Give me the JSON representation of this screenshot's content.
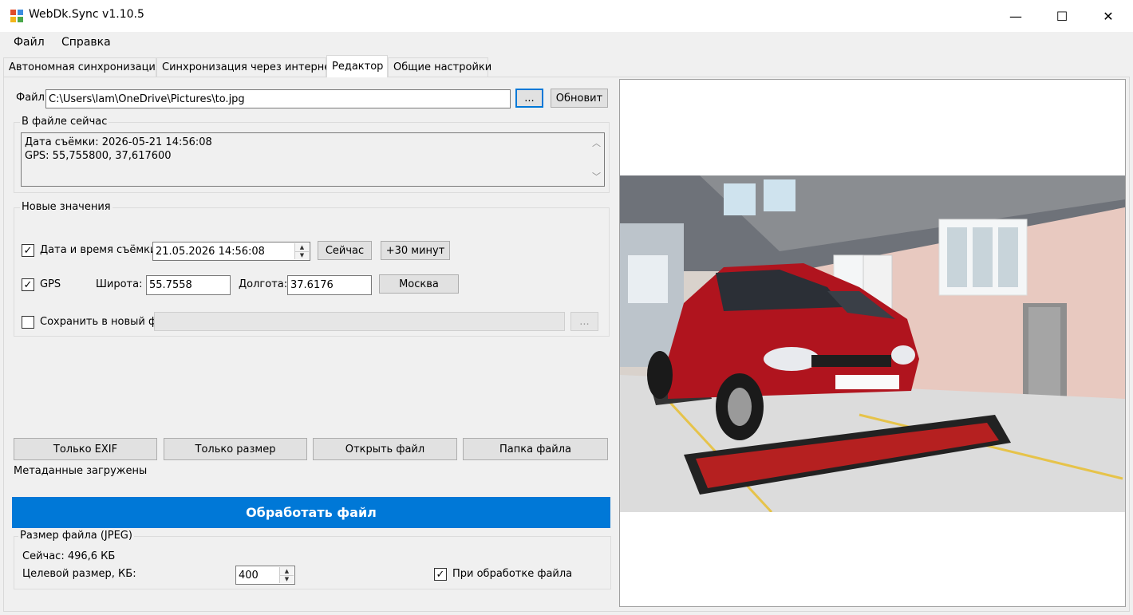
{
  "window": {
    "title": "WebDk.Sync v1.10.5",
    "minimize": "—",
    "maximize": "☐",
    "close": "✕"
  },
  "menu": {
    "file": "Файл",
    "help": "Справка"
  },
  "tabs": [
    {
      "label": "Автономная синхронизация"
    },
    {
      "label": "Синхронизация через интернет"
    },
    {
      "label": "Редактор"
    },
    {
      "label": "Общие настройки"
    }
  ],
  "file": {
    "label": "Файл",
    "path": "C:\\Users\\lam\\OneDrive\\Pictures\\to.jpg",
    "browse": "...",
    "refresh": "Обновит"
  },
  "current": {
    "legend": "В файле сейчас",
    "line1": "Дата съёмки: 2026-05-21 14:56:08",
    "line2": "GPS: 55,755800, 37,617600"
  },
  "new_values": {
    "legend": "Новые значения",
    "datetime_label": "Дата и время съёмки",
    "datetime_value": "21.05.2026 14:56:08",
    "now_button": "Сейчас",
    "plus30_button": "+30 минут",
    "gps_label": "GPS",
    "lat_label": "Широта:",
    "lat_value": "55.7558",
    "lon_label": "Долгота:",
    "lon_value": "37.6176",
    "moscow_button": "Москва",
    "save_new_label": "Сохранить в новый фа",
    "save_new_path": "",
    "save_new_browse": "..."
  },
  "actions": {
    "exif_only": "Только EXIF",
    "size_only": "Только размер",
    "open_file": "Открыть файл",
    "file_folder": "Папка файла"
  },
  "status": "Метаданные загружены",
  "process_button": "Обработать файл",
  "filesize": {
    "legend": "Размер файла (JPEG)",
    "current": "Сейчас: 496,6 КБ",
    "target_label": "Целевой размер, КБ:",
    "target_value": "400",
    "on_process_label": "При обработке файла"
  },
  "colors": {
    "accent": "#0078d7",
    "car": "#b0141e"
  },
  "icons": {
    "check": "✓",
    "spin_up": "▲",
    "spin_down": "▼",
    "scroll_up": "︿",
    "scroll_down": "﹀"
  }
}
